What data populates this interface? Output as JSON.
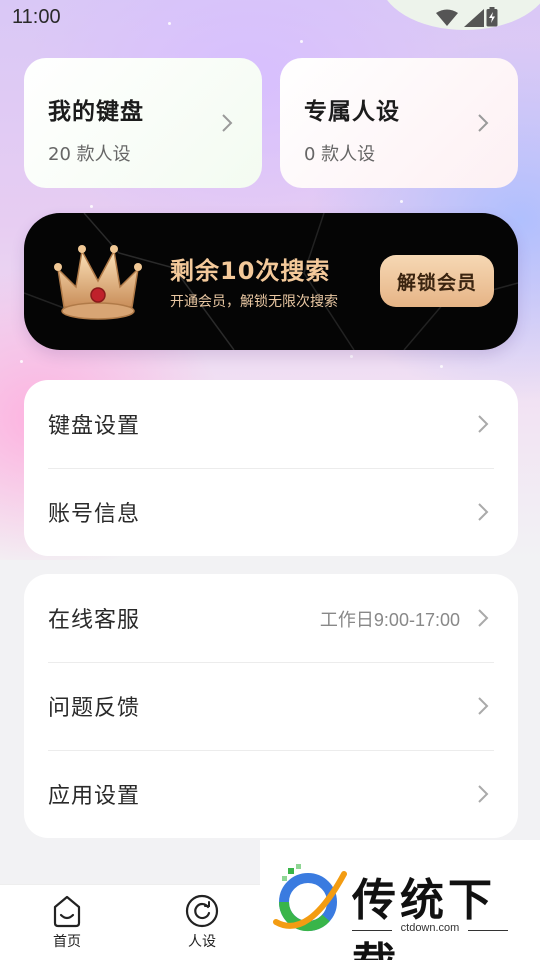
{
  "status_bar": {
    "time": "11:00",
    "icons": [
      "wifi-icon",
      "signal-icon",
      "battery-charging-icon"
    ]
  },
  "top_cards": [
    {
      "title": "我的键盘",
      "subtitle": "20 款人设"
    },
    {
      "title": "专属人设",
      "subtitle": "0 款人设"
    }
  ],
  "vip_banner": {
    "title": "剩余10次搜索",
    "subtitle": "开通会员，解锁无限次搜索",
    "button_label": "解锁会员",
    "accent_color": "#f4c99a",
    "icon": "crown-icon"
  },
  "menu_groups": [
    {
      "items": [
        {
          "label": "键盘设置"
        },
        {
          "label": "账号信息"
        }
      ]
    },
    {
      "items": [
        {
          "label": "在线客服",
          "extra": "工作日9:00-17:00"
        },
        {
          "label": "问题反馈"
        },
        {
          "label": "应用设置"
        }
      ]
    }
  ],
  "bottom_nav": {
    "items": [
      {
        "label": "首页",
        "icon": "home-face-icon"
      },
      {
        "label": "人设",
        "icon": "persona-refresh-icon"
      }
    ]
  },
  "watermark": {
    "text": "传统下载",
    "url": "ctdown.com"
  }
}
